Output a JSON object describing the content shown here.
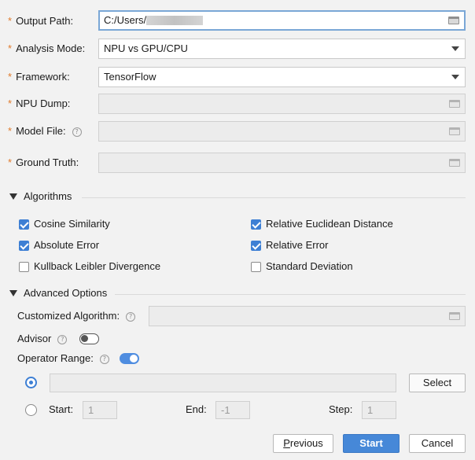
{
  "form": {
    "output_path": {
      "label": "Output Path:",
      "value": "C:/Users/",
      "required": "*"
    },
    "analysis_mode": {
      "label": "Analysis Mode:",
      "value": "NPU vs GPU/CPU",
      "required": "*"
    },
    "framework": {
      "label": "Framework:",
      "value": "TensorFlow",
      "required": "*"
    },
    "npu_dump": {
      "label": "NPU Dump:",
      "value": "",
      "required": "*"
    },
    "model_file": {
      "label": "Model File:",
      "value": "",
      "required": "*"
    },
    "ground_truth": {
      "label": "Ground Truth:",
      "value": "",
      "required": "*"
    }
  },
  "help_glyph": "?",
  "algorithms": {
    "title": "Algorithms",
    "items": [
      {
        "label": "Cosine Similarity",
        "checked": true
      },
      {
        "label": "Relative Euclidean Distance",
        "checked": true
      },
      {
        "label": "Absolute Error",
        "checked": true
      },
      {
        "label": "Relative Error",
        "checked": true
      },
      {
        "label": "Kullback Leibler Divergence",
        "checked": false
      },
      {
        "label": "Standard Deviation",
        "checked": false
      }
    ]
  },
  "advanced": {
    "title": "Advanced Options",
    "customized_algorithm": {
      "label": "Customized Algorithm:",
      "value": ""
    },
    "advisor": {
      "label": "Advisor",
      "enabled": false
    },
    "operator_range": {
      "label": "Operator Range:",
      "enabled": true
    },
    "select_label": "Select",
    "start": {
      "label": "Start:",
      "value": "1"
    },
    "end": {
      "label": "End:",
      "value": "-1"
    },
    "step": {
      "label": "Step:",
      "value": "1"
    }
  },
  "footer": {
    "previous_label": "Previous",
    "start_label": "Start",
    "cancel_label": "Cancel"
  },
  "colors": {
    "accent": "#4688d8",
    "required": "#e07a2b",
    "background": "#f2f2f2"
  },
  "icons": {
    "browse": "folder-icon",
    "dropdown": "chevron-down-icon",
    "section": "triangle-down-icon",
    "help": "help-icon"
  }
}
